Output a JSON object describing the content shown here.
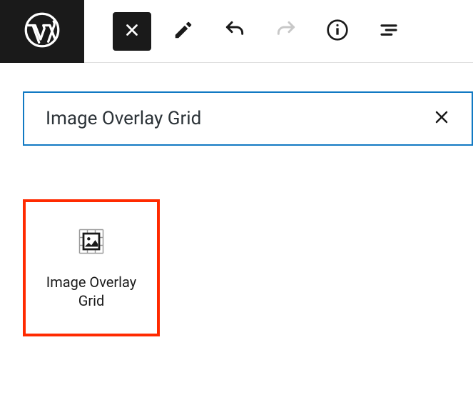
{
  "toolbar": {
    "close_label": "Close",
    "edit_label": "Edit",
    "undo_label": "Undo",
    "redo_label": "Redo",
    "info_label": "Info",
    "list_label": "List view"
  },
  "search": {
    "value": "Image Overlay Grid",
    "clear_label": "Clear"
  },
  "results": {
    "items": [
      {
        "label": "Image Overlay\nGrid",
        "icon": "image-overlay-grid-icon"
      }
    ]
  }
}
